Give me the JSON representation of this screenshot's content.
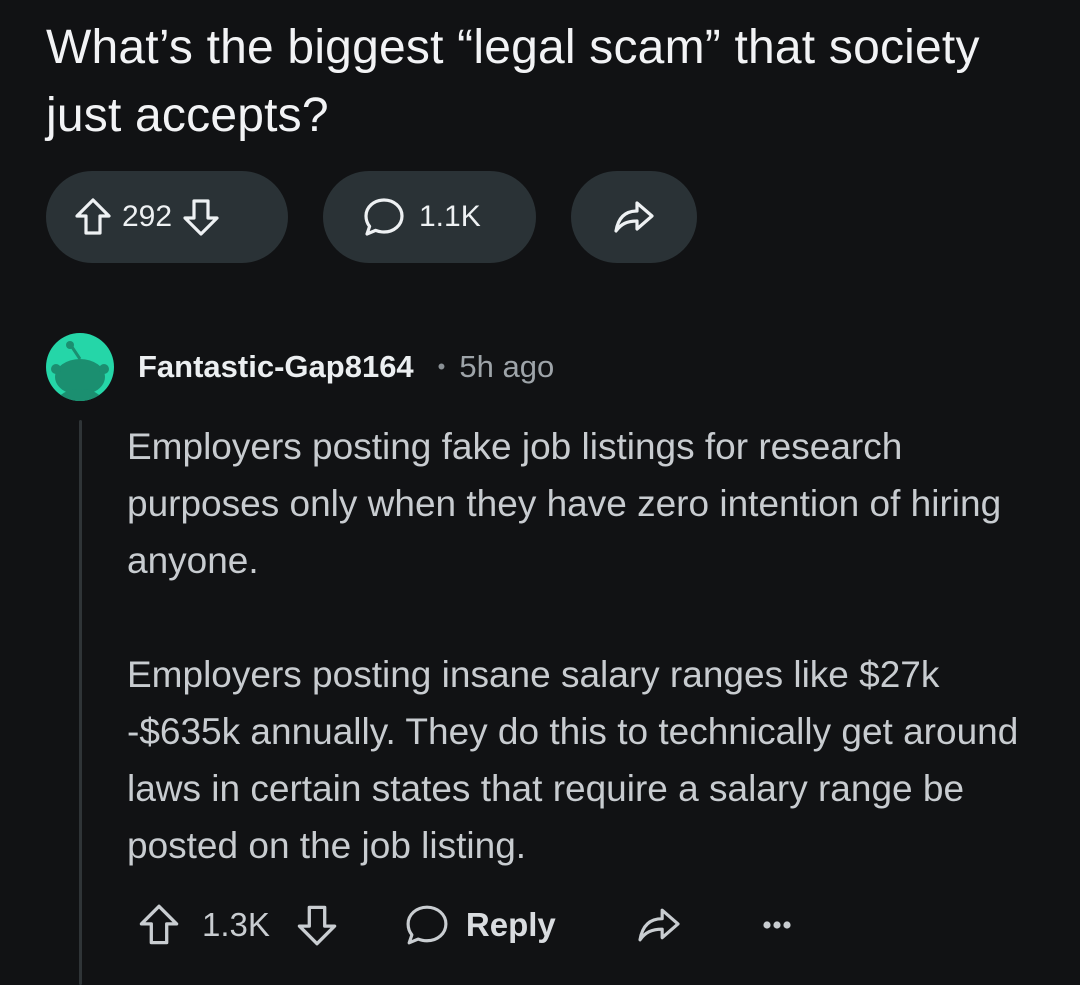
{
  "post": {
    "title": "What’s the biggest “legal scam” that society just accepts?",
    "vote_count": "292",
    "comment_count": "1.1K"
  },
  "icons": {
    "upvote": "upvote-arrow-icon",
    "downvote": "downvote-arrow-icon",
    "comment": "comment-bubble-icon",
    "share": "share-arrow-icon",
    "more": "more-dots-icon",
    "avatar": "reddit-snoo-avatar"
  },
  "colors": {
    "background": "#111214",
    "pill": "#2a3236",
    "avatar": "#25d6a8"
  },
  "comment": {
    "author": "Fantastic-Gap8164",
    "separator": "•",
    "time": "5h ago",
    "paragraphs": [
      "Employers posting fake job listings for research purposes only when they have zero intention of hiring anyone.",
      "Employers posting insane salary ranges like $27k -$635k annually. They do this to technically get around laws in certain states that require a salary range be posted on the job listing."
    ],
    "vote_count": "1.3K",
    "reply_label": "Reply"
  }
}
